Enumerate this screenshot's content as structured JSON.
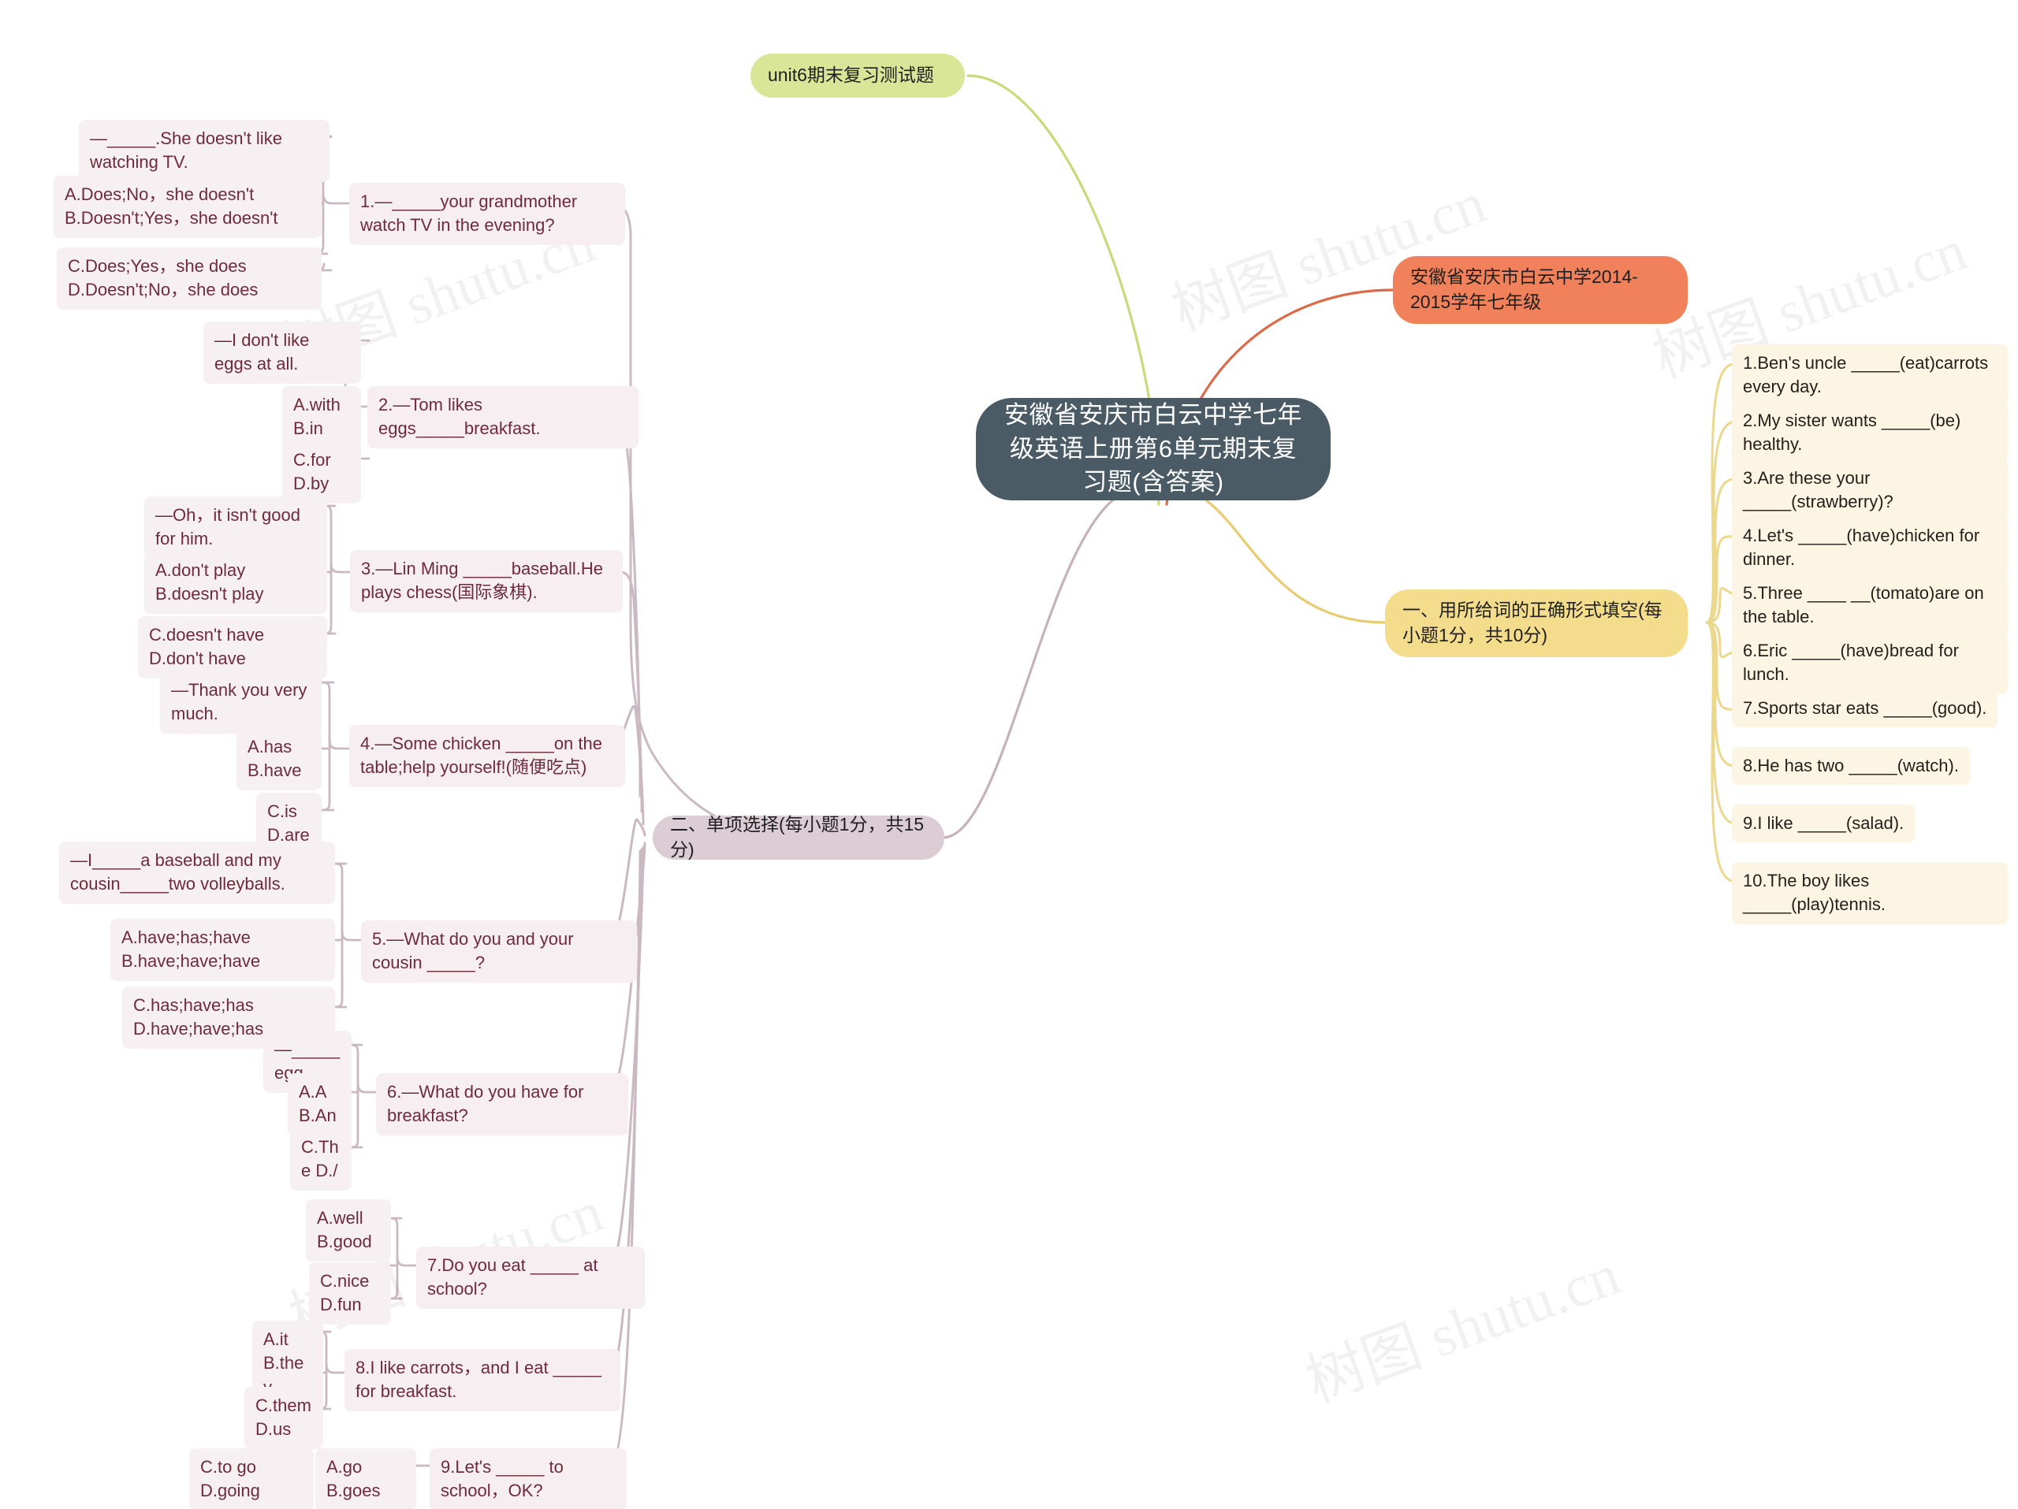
{
  "root": {
    "label": "安徽省安庆市白云中学七年级英语上册第6单元期末复习题(含答案)"
  },
  "branches": {
    "green": {
      "label": "unit6期末复习测试题",
      "color": "#d9e698"
    },
    "orange": {
      "label": "安徽省安庆市白云中学2014-2015学年七年级",
      "color": "#f0815a"
    },
    "yellow": {
      "label": "一、用所给词的正确形式填空(每小题1分，共10分)",
      "color": "#f4dc8d"
    },
    "mauve": {
      "label": "二、单项选择(每小题1分，共15分)",
      "color": "#dccdd4"
    }
  },
  "fill_in_blanks": [
    {
      "text": "1.Ben's uncle _____(eat)carrots every day."
    },
    {
      "text": "2.My sister wants _____(be) healthy."
    },
    {
      "text": "3.Are these your _____(strawberry)?"
    },
    {
      "text": "4.Let's _____(have)chicken for dinner."
    },
    {
      "text": "5.Three ____ __(tomato)are on the table."
    },
    {
      "text": "6.Eric _____(have)bread for lunch."
    },
    {
      "text": "7.Sports star eats _____(good)."
    },
    {
      "text": "8.He has two _____(watch)."
    },
    {
      "text": "9.I like _____(salad)."
    },
    {
      "text": "10.The boy likes _____(play)tennis."
    }
  ],
  "multiple_choice": [
    {
      "question": "1.—_____your grandmother watch TV in the evening?",
      "options": [
        "—_____.She doesn't like watching TV.",
        "A.Does;No，she doesn't B.Doesn't;Yes，she doesn't",
        "C.Does;Yes，she does D.Doesn't;No，she does"
      ]
    },
    {
      "question": "2.—Tom likes eggs_____breakfast.",
      "options": [
        "—I don't like eggs at all.",
        "A.with B.in",
        "C.for D.by"
      ]
    },
    {
      "question": "3.—Lin Ming _____baseball.He plays chess(国际象棋).",
      "options": [
        "—Oh，it isn't good for him.",
        "A.don't play B.doesn't play",
        "C.doesn't have D.don't have"
      ]
    },
    {
      "question": "4.—Some chicken _____on the table;help yourself!(随便吃点)",
      "options": [
        "—Thank you very much.",
        "A.has B.have",
        "C.is D.are"
      ]
    },
    {
      "question": "5.—What do you and your cousin _____?",
      "options": [
        "—I_____a baseball and my cousin_____two volleyballs.",
        "A.have;has;have B.have;have;have",
        "C.has;have;has D.have;have;has"
      ]
    },
    {
      "question": "6.—What do you have for breakfast?",
      "options": [
        "—_____ egg.",
        "A.A B.An",
        "C.The D./"
      ]
    },
    {
      "question": "7.Do you eat _____ at school?",
      "options": [
        "A.well B.good",
        "C.nice D.fun"
      ]
    },
    {
      "question": "8.I like carrots，and I eat _____ for breakfast.",
      "options": [
        "A.it B.they",
        "C.them D.us"
      ]
    },
    {
      "question": "9.Let's _____ to school，OK?",
      "options": [
        "A.go B.goes",
        "C.to go D.going"
      ]
    }
  ],
  "watermarks": [
    "树图 shutu.cn",
    "树图 shutu.cn",
    "树图 shutu.cn",
    "树图 shutu.cn",
    "树图 shutu.cn"
  ]
}
